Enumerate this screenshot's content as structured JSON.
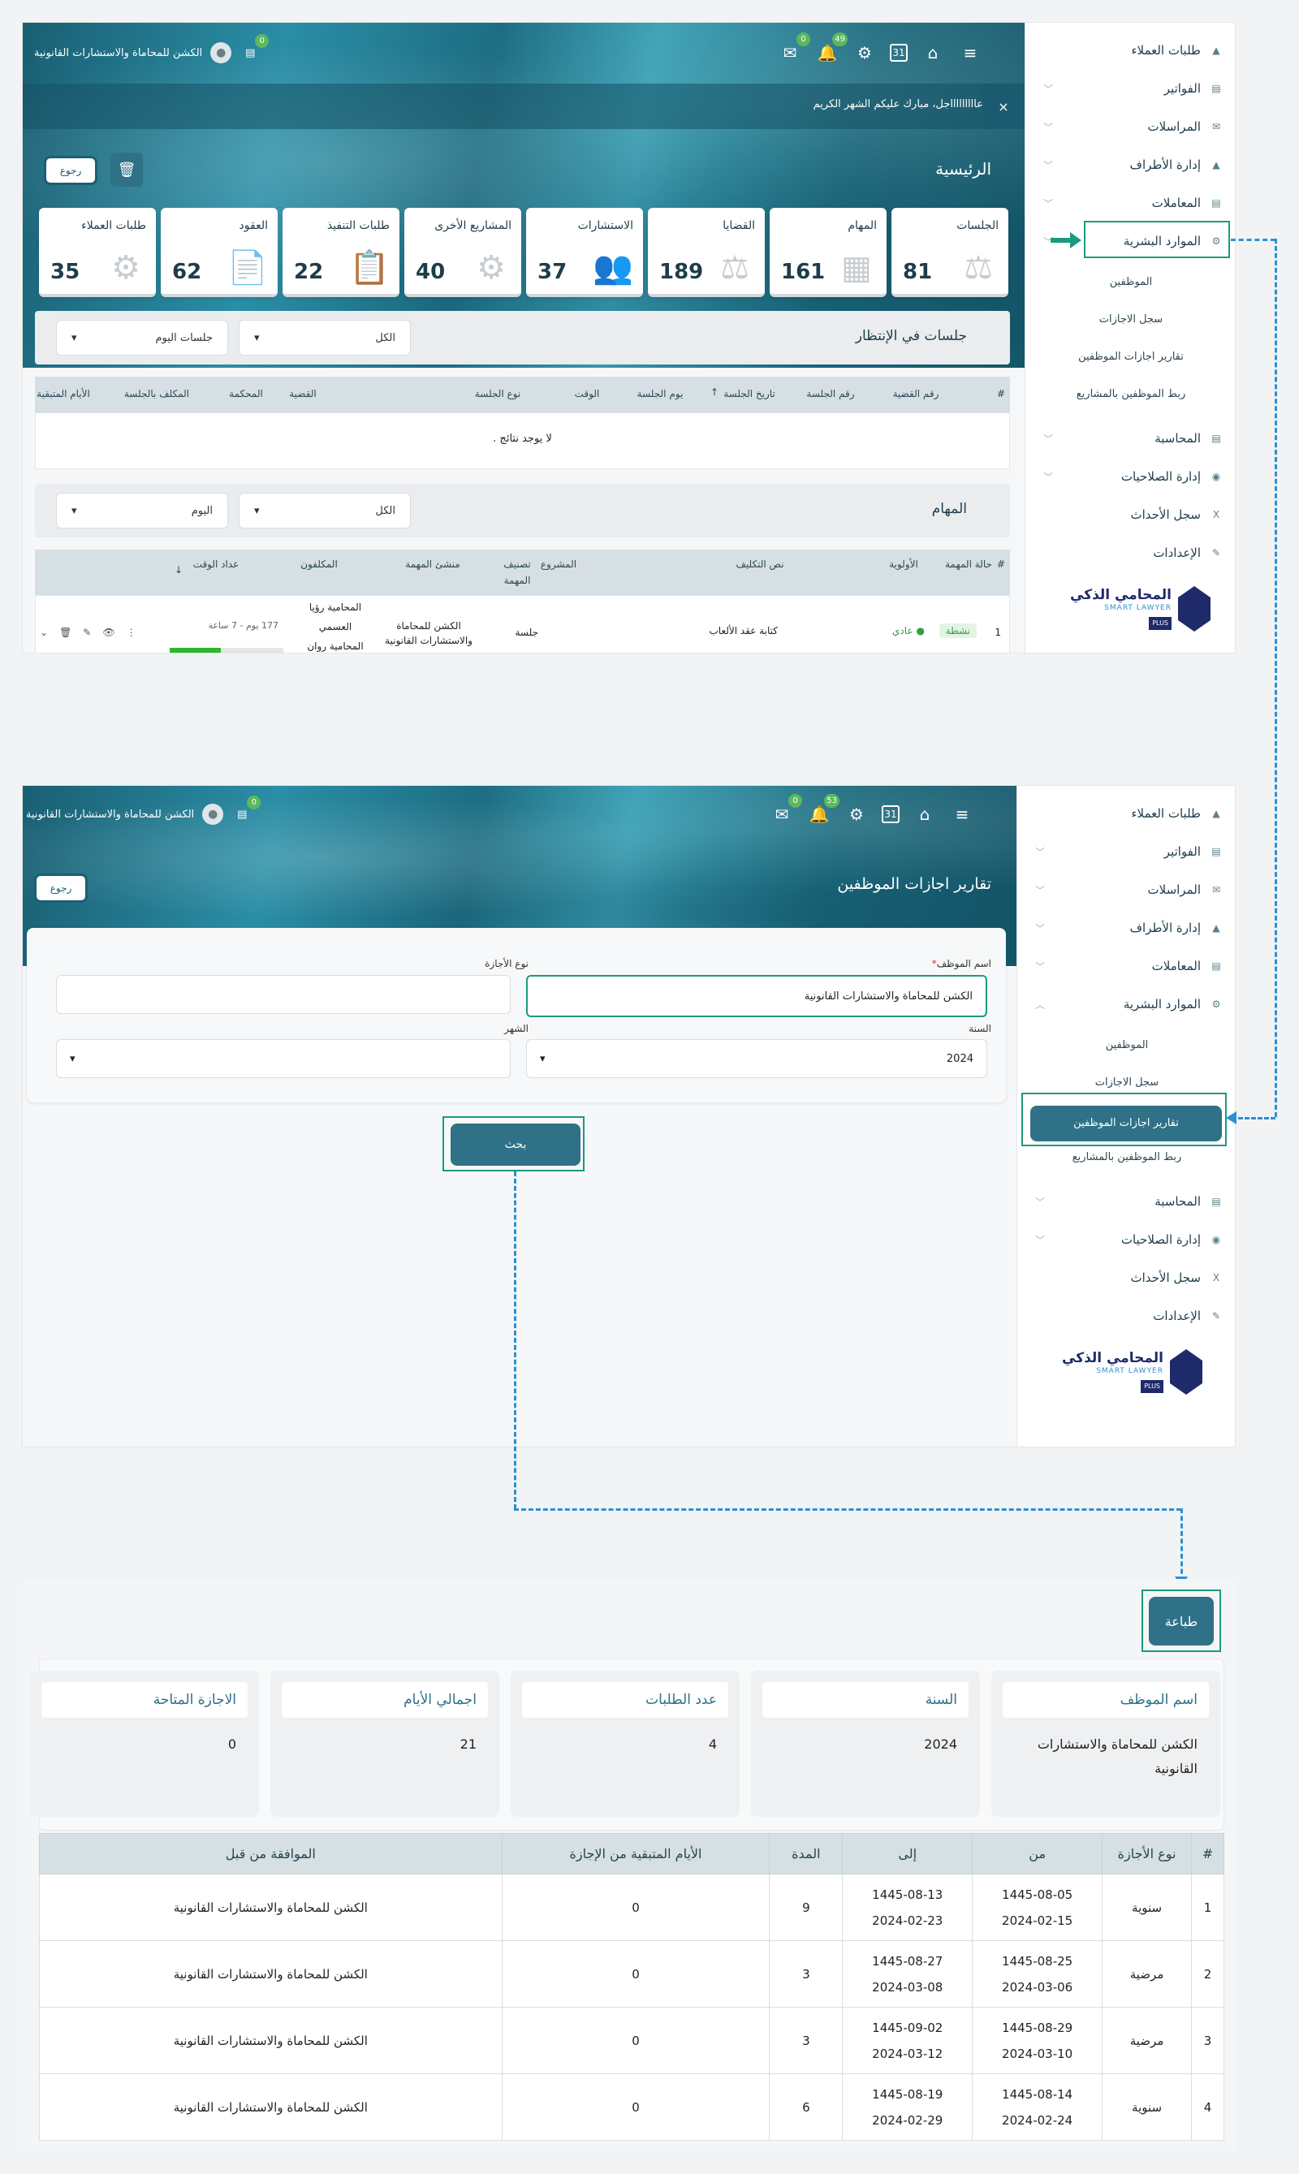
{
  "firm_name": "الكشن للمحاماة والاستشارات القانونية",
  "badges": {
    "chat": "0",
    "notifications": "49",
    "messages": "0",
    "notifications2": "53"
  },
  "calendar_day": "31",
  "announcement": "عاااااااااجل، مبارك عليكم الشهر الكريم",
  "announcement_close": "×",
  "home": {
    "title": "الرئيسية",
    "back": "رجوع",
    "cards": [
      {
        "title": "الجلسات",
        "value": "81",
        "icon": "gavel-icon"
      },
      {
        "title": "المهام",
        "value": "161",
        "icon": "calendar-icon"
      },
      {
        "title": "القضايا",
        "value": "189",
        "icon": "scales-icon"
      },
      {
        "title": "الاستشارات",
        "value": "37",
        "icon": "people-icon"
      },
      {
        "title": "المشاريع الأخرى",
        "value": "40",
        "icon": "project-icon"
      },
      {
        "title": "طلبات التنفيذ",
        "value": "22",
        "icon": "clipboard-icon"
      },
      {
        "title": "العقود",
        "value": "62",
        "icon": "contract-icon"
      },
      {
        "title": "طلبات العملاء",
        "value": "35",
        "icon": "users-gear-icon"
      }
    ],
    "sessions": {
      "title": "جلسات في الإنتظار",
      "filter1": "الكل",
      "filter2": "جلسات اليوم",
      "columns": [
        "#",
        "رقم القضية",
        "رقم الجلسة",
        "تاريخ الجلسة",
        "يوم الجلسة",
        "الوقت",
        "نوع الجلسة",
        "القضية",
        "المحكمة",
        "المكلف بالجلسة",
        "الأيام المتبقية"
      ],
      "sort_arrow": "↑",
      "empty": "لا يوجد نتائج ."
    },
    "tasks": {
      "title": "المهام",
      "filter1": "الكل",
      "filter2": "اليوم",
      "columns": [
        "#",
        "حالة المهمة",
        "الأولوية",
        "نص التكليف",
        "المشروع",
        "تصنيف المهمة",
        "منشئ المهمة",
        "المكلفون",
        "عداد الوقت"
      ],
      "sort_arrow": "↓",
      "row": {
        "num": "1",
        "status": "نشطة",
        "priority": "عادي",
        "text": "كتابة عقد الألعاب",
        "category": "جلسة",
        "creator": "الكشن للمحاماة والاستشارات القانونية",
        "assignees": "المحامية رؤيا العسمي المحامية روان",
        "timer": "177 يوم - 7 ساعة"
      }
    }
  },
  "sidebar": {
    "items": [
      {
        "label": "طلبات العملاء",
        "icon": "hat-icon"
      },
      {
        "label": "الفواتير",
        "icon": "invoice-icon"
      },
      {
        "label": "المراسلات",
        "icon": "mail-icon"
      },
      {
        "label": "إدارة الأطراف",
        "icon": "parties-icon"
      },
      {
        "label": "المعاملات",
        "icon": "transactions-icon"
      },
      {
        "label": "الموارد البشرية",
        "icon": "hr-icon"
      }
    ],
    "hr_sub": [
      "الموظفين",
      "سجل الاجازات",
      "تقارير اجازات الموظفين",
      "ربط الموظفين بالمشاريع"
    ],
    "items2": [
      {
        "label": "المحاسبة",
        "icon": "accounting-icon"
      },
      {
        "label": "إدارة الصلاحيات",
        "icon": "permissions-icon"
      },
      {
        "label": "سجل الأحداث",
        "icon": "excel-icon"
      },
      {
        "label": "الإعدادات",
        "icon": "wrench-icon"
      }
    ],
    "logo_ar": "المحامي الذكي",
    "logo_en": "SMART LAWYER",
    "logo_plus": "PLUS"
  },
  "report_form": {
    "title": "تقارير اجازات الموظفين",
    "back": "رجوع",
    "employee_label": "اسم الموظف",
    "required_mark": "*",
    "employee_value": "الكشن للمحاماة والاستشارات القانونية",
    "leave_type_label": "نوع الأجازة",
    "leave_type_value": "",
    "year_label": "السنة",
    "year_value": "2024",
    "month_label": "الشهر",
    "month_value": "",
    "search": "بحث"
  },
  "report": {
    "print": "طباعة",
    "summary": [
      {
        "label": "اسم الموظف",
        "value": "الكشن للمحاماة والاستشارات القانونية"
      },
      {
        "label": "السنة",
        "value": "2024"
      },
      {
        "label": "عدد الطلبات",
        "value": "4"
      },
      {
        "label": "اجمالي الأيام",
        "value": "21"
      },
      {
        "label": "الاجازة المتاحة",
        "value": "0"
      }
    ],
    "columns": [
      "#",
      "نوع الأجازة",
      "من",
      "إلى",
      "المدة",
      "الأيام المتبقية من الإجازة",
      "الموافقة من قبل"
    ],
    "rows": [
      {
        "num": "1",
        "type": "سنوية",
        "from_h": "1445-08-05",
        "from_g": "2024-02-15",
        "to_h": "1445-08-13",
        "to_g": "2024-02-23",
        "duration": "9",
        "remaining": "0",
        "approved_by": "الكشن للمحاماة والاستشارات القانونية"
      },
      {
        "num": "2",
        "type": "مرضية",
        "from_h": "1445-08-25",
        "from_g": "2024-03-06",
        "to_h": "1445-08-27",
        "to_g": "2024-03-08",
        "duration": "3",
        "remaining": "0",
        "approved_by": "الكشن للمحاماة والاستشارات القانونية"
      },
      {
        "num": "3",
        "type": "مرضية",
        "from_h": "1445-08-29",
        "from_g": "2024-03-10",
        "to_h": "1445-09-02",
        "to_g": "2024-03-12",
        "duration": "3",
        "remaining": "0",
        "approved_by": "الكشن للمحاماة والاستشارات القانونية"
      },
      {
        "num": "4",
        "type": "سنوية",
        "from_h": "1445-08-14",
        "from_g": "2024-02-24",
        "to_h": "1445-08-19",
        "to_g": "2024-02-29",
        "duration": "6",
        "remaining": "0",
        "approved_by": "الكشن للمحاماة والاستشارات القانونية"
      }
    ]
  }
}
